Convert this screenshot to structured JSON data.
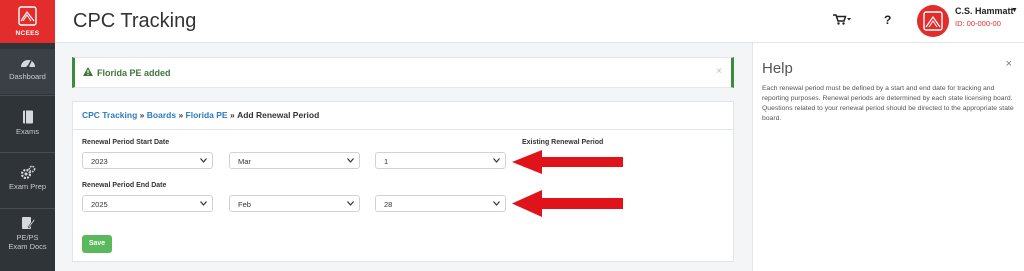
{
  "brand": {
    "logo_text": "NCEES",
    "color": "#e32d2d"
  },
  "sidebar": {
    "items": [
      {
        "label": "Dashboard",
        "icon": "dashboard-icon"
      },
      {
        "label": "Exams",
        "icon": "book-icon"
      },
      {
        "label": "Exam Prep",
        "icon": "gears-icon"
      },
      {
        "label": "PE/PS Exam Docs",
        "label_line1": "PE/PS",
        "label_line2": "Exam Docs",
        "icon": "document-edit-icon"
      }
    ]
  },
  "header": {
    "title": "CPC Tracking",
    "cart_icon": "cart-icon",
    "help_label": "?",
    "user": {
      "name": "C.S. Hammatt",
      "id": "ID: 00-000-00"
    }
  },
  "alert": {
    "text": "Florida PE added",
    "close": "×",
    "color": "#3c763d"
  },
  "breadcrumb": {
    "items": [
      "CPC Tracking",
      "Boards",
      "Florida PE"
    ],
    "separator": "»",
    "current": "Add Renewal Period"
  },
  "form": {
    "start_label": "Renewal Period Start Date",
    "start": {
      "year": "2023",
      "month": "Mar",
      "day": "1"
    },
    "existing_label": "Existing Renewal Period",
    "end_label": "Renewal Period End Date",
    "end": {
      "year": "2025",
      "month": "Feb",
      "day": "28"
    },
    "save_label": "Save"
  },
  "help_panel": {
    "title": "Help",
    "close": "×",
    "body": "Each renewal period must be defined by a start and end date for tracking and reporting purposes. Renewal periods are determined by each state licensing board. Questions related to your renewal period should be directed to the appropriate state board."
  },
  "annotation_color": "#e0121a"
}
